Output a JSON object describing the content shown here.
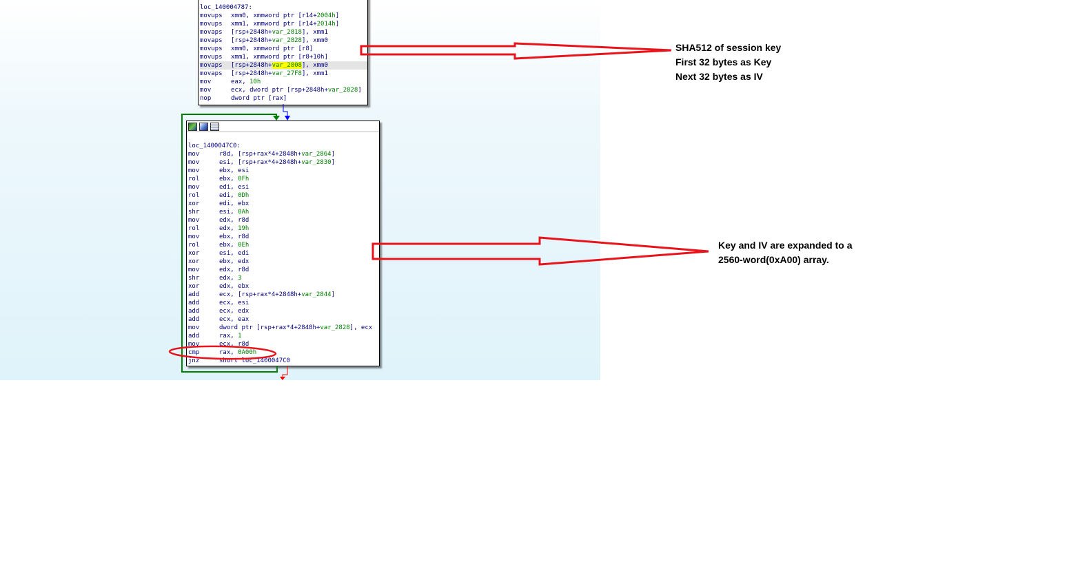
{
  "block1": {
    "label": "loc_140004787:",
    "lines": [
      {
        "m": "movups",
        "p": [
          {
            "t": "xmm0, xmmword ptr [r14+",
            "c": "op"
          },
          {
            "t": "2004h",
            "c": "nm"
          },
          {
            "t": "]",
            "c": "op"
          }
        ]
      },
      {
        "m": "movups",
        "p": [
          {
            "t": "xmm1, xmmword ptr [r14+",
            "c": "op"
          },
          {
            "t": "2014h",
            "c": "nm"
          },
          {
            "t": "]",
            "c": "op"
          }
        ]
      },
      {
        "m": "movaps",
        "p": [
          {
            "t": "[rsp+2848h+",
            "c": "op"
          },
          {
            "t": "var_2818",
            "c": "vr"
          },
          {
            "t": "], xmm1",
            "c": "op"
          }
        ]
      },
      {
        "m": "movaps",
        "p": [
          {
            "t": "[rsp+2848h+",
            "c": "op"
          },
          {
            "t": "var_2828",
            "c": "vr"
          },
          {
            "t": "], xmm0",
            "c": "op"
          }
        ]
      },
      {
        "m": "movups",
        "p": [
          {
            "t": "xmm0, xmmword ptr [r8]",
            "c": "op"
          }
        ]
      },
      {
        "m": "movups",
        "p": [
          {
            "t": "xmm1, xmmword ptr [r8+10h]",
            "c": "op"
          }
        ]
      },
      {
        "m": "movaps",
        "hl": true,
        "p": [
          {
            "t": "[rsp+2848h+",
            "c": "op"
          },
          {
            "t": "var_2808",
            "c": "vr yl"
          },
          {
            "t": "], xmm0",
            "c": "op"
          }
        ]
      },
      {
        "m": "movaps",
        "p": [
          {
            "t": "[rsp+2848h+",
            "c": "op"
          },
          {
            "t": "var_27F8",
            "c": "vr"
          },
          {
            "t": "], xmm1",
            "c": "op"
          }
        ]
      },
      {
        "m": "mov",
        "p": [
          {
            "t": "eax, ",
            "c": "op"
          },
          {
            "t": "10h",
            "c": "nm"
          }
        ]
      },
      {
        "m": "mov",
        "p": [
          {
            "t": "ecx, dword ptr [rsp+2848h+",
            "c": "op"
          },
          {
            "t": "var_2828",
            "c": "vr"
          },
          {
            "t": "]",
            "c": "op"
          }
        ]
      },
      {
        "m": "nop",
        "p": [
          {
            "t": "dword ptr [rax]",
            "c": "op"
          }
        ]
      }
    ]
  },
  "block2": {
    "label": "loc_1400047C0:",
    "lines": [
      {
        "m": "mov",
        "p": [
          {
            "t": "r8d, [rsp+rax*4+2848h+",
            "c": "op"
          },
          {
            "t": "var_2864",
            "c": "vr"
          },
          {
            "t": "]",
            "c": "op"
          }
        ]
      },
      {
        "m": "mov",
        "p": [
          {
            "t": "esi, [rsp+rax*4+2848h+",
            "c": "op"
          },
          {
            "t": "var_2830",
            "c": "vr"
          },
          {
            "t": "]",
            "c": "op"
          }
        ]
      },
      {
        "m": "mov",
        "p": [
          {
            "t": "ebx, esi",
            "c": "op"
          }
        ]
      },
      {
        "m": "rol",
        "p": [
          {
            "t": "ebx, ",
            "c": "op"
          },
          {
            "t": "0Fh",
            "c": "nm"
          }
        ]
      },
      {
        "m": "mov",
        "p": [
          {
            "t": "edi, esi",
            "c": "op"
          }
        ]
      },
      {
        "m": "rol",
        "p": [
          {
            "t": "edi, ",
            "c": "op"
          },
          {
            "t": "0Dh",
            "c": "nm"
          }
        ]
      },
      {
        "m": "xor",
        "p": [
          {
            "t": "edi, ebx",
            "c": "op"
          }
        ]
      },
      {
        "m": "shr",
        "p": [
          {
            "t": "esi, ",
            "c": "op"
          },
          {
            "t": "0Ah",
            "c": "nm"
          }
        ]
      },
      {
        "m": "mov",
        "p": [
          {
            "t": "edx, r8d",
            "c": "op"
          }
        ]
      },
      {
        "m": "rol",
        "p": [
          {
            "t": "edx, ",
            "c": "op"
          },
          {
            "t": "19h",
            "c": "nm"
          }
        ]
      },
      {
        "m": "mov",
        "p": [
          {
            "t": "ebx, r8d",
            "c": "op"
          }
        ]
      },
      {
        "m": "rol",
        "p": [
          {
            "t": "ebx, ",
            "c": "op"
          },
          {
            "t": "0Eh",
            "c": "nm"
          }
        ]
      },
      {
        "m": "xor",
        "p": [
          {
            "t": "esi, edi",
            "c": "op"
          }
        ]
      },
      {
        "m": "xor",
        "p": [
          {
            "t": "ebx, edx",
            "c": "op"
          }
        ]
      },
      {
        "m": "mov",
        "p": [
          {
            "t": "edx, r8d",
            "c": "op"
          }
        ]
      },
      {
        "m": "shr",
        "p": [
          {
            "t": "edx, ",
            "c": "op"
          },
          {
            "t": "3",
            "c": "nm"
          }
        ]
      },
      {
        "m": "xor",
        "p": [
          {
            "t": "edx, ebx",
            "c": "op"
          }
        ]
      },
      {
        "m": "add",
        "p": [
          {
            "t": "ecx, [rsp+rax*4+2848h+",
            "c": "op"
          },
          {
            "t": "var_2844",
            "c": "vr"
          },
          {
            "t": "]",
            "c": "op"
          }
        ]
      },
      {
        "m": "add",
        "p": [
          {
            "t": "ecx, esi",
            "c": "op"
          }
        ]
      },
      {
        "m": "add",
        "p": [
          {
            "t": "ecx, edx",
            "c": "op"
          }
        ]
      },
      {
        "m": "add",
        "p": [
          {
            "t": "ecx, eax",
            "c": "op"
          }
        ]
      },
      {
        "m": "mov",
        "p": [
          {
            "t": "dword ptr [rsp+rax*4+2848h+",
            "c": "op"
          },
          {
            "t": "var_2828",
            "c": "vr"
          },
          {
            "t": "], ecx",
            "c": "op"
          }
        ]
      },
      {
        "m": "add",
        "p": [
          {
            "t": "rax, ",
            "c": "op"
          },
          {
            "t": "1",
            "c": "nm"
          }
        ]
      },
      {
        "m": "mov",
        "p": [
          {
            "t": "ecx, r8d",
            "c": "op"
          }
        ]
      },
      {
        "m": "cmp",
        "p": [
          {
            "t": "rax, ",
            "c": "op"
          },
          {
            "t": "0A00h",
            "c": "nm"
          }
        ]
      },
      {
        "m": "jnz",
        "p": [
          {
            "t": "short loc_1400047C0",
            "c": "op"
          }
        ]
      }
    ]
  },
  "annotations": {
    "note1": [
      "SHA512 of session key",
      "First 32 bytes as Key",
      "Next 32 bytes as IV"
    ],
    "note2": [
      "Key and IV are expanded to a",
      "2560-word(0xA00) array."
    ]
  },
  "toolbar_icons": [
    "graph-icon",
    "edit-graph-icon",
    "text-view-icon"
  ],
  "colors": {
    "annotation_red": "#e8141b",
    "loop_back_edge": "#008000",
    "fallthrough_edge": "#0000ff",
    "exit_edge": "#ff0000",
    "number_green": "#008000",
    "text_navy": "#000080",
    "highlight_yellow": "#ffff00"
  }
}
